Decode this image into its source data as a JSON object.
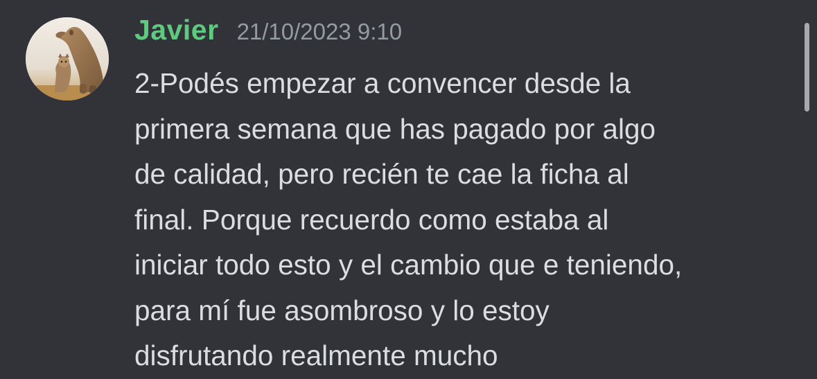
{
  "message": {
    "avatar_icon": "user-avatar-puma",
    "author": "Javier",
    "author_color": "#5fc97f",
    "timestamp": "21/10/2023 9:10",
    "lines": [
      "2-Podés empezar a convencer desde la",
      "primera semana que has pagado por algo",
      "de calidad, pero recién te cae la ficha al",
      "final. Porque recuerdo como estaba al",
      "iniciar todo esto y el cambio que e teniendo,",
      "para mí fue asombroso y lo estoy",
      "disfrutando realmente mucho"
    ]
  },
  "colors": {
    "background": "#313338",
    "text": "#dbdee1",
    "timestamp": "#949ba4"
  }
}
